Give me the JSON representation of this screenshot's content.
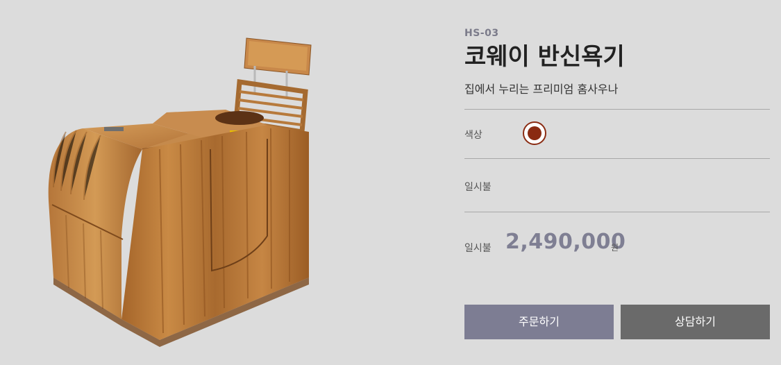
{
  "product": {
    "model": "HS-03",
    "title": "코웨이 반신욕기",
    "subtitle": "집에서 누리는 프리미엄 홈사우나"
  },
  "options": {
    "color_label": "색상",
    "color_swatch": "#8a2b12",
    "payment_label": "일시불"
  },
  "price": {
    "label": "일시불",
    "value": "2,490,000",
    "unit": "원"
  },
  "buttons": {
    "order": "주문하기",
    "consult": "상담하기"
  }
}
